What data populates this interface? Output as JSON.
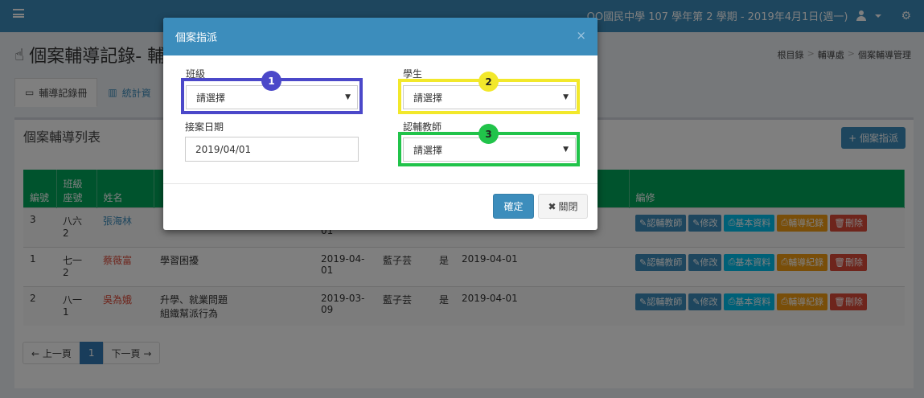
{
  "header": {
    "school_info": "OO國民中學 107 學年第 2 學期 - 2019年4月1日(週一)"
  },
  "page": {
    "title": "個案輔導記錄- 輔",
    "breadcrumb": [
      "根目錄",
      "輔導處",
      "個案輔導管理"
    ]
  },
  "tabs": [
    {
      "label": "輔導記錄冊"
    },
    {
      "label": "統計資"
    }
  ],
  "panel": {
    "title": "個案輔導列表",
    "assign_button": "+ 個案指派"
  },
  "table": {
    "headers": [
      "編號",
      "班級座號",
      "姓名",
      "",
      "",
      "",
      "",
      "",
      "",
      "",
      "編修"
    ],
    "header_class_line1": "班級",
    "header_class_line2": "座號",
    "rows": [
      {
        "no": "3",
        "cls": "八六 2",
        "name": "張海林",
        "issue1": "",
        "issue2": "",
        "date1": "",
        "date2": "01",
        "teacher": "",
        "yes": "",
        "date3": ""
      },
      {
        "no": "1",
        "cls": "七一 2",
        "name": "蔡薇富",
        "issue1": "學習困擾",
        "issue2": "",
        "date1": "2019-04-",
        "date2": "01",
        "teacher": "藍子芸",
        "yes": "是",
        "date3": "2019-04-01"
      },
      {
        "no": "2",
        "cls": "八一 1",
        "name": "吳為娥",
        "issue1": "升學、就業問題",
        "issue2": "組織幫派行為",
        "date1": "2019-03-",
        "date2": "09",
        "teacher": "藍子芸",
        "yes": "是",
        "date3": "2019-04-01"
      }
    ],
    "actions": [
      "認輔教師",
      "修改",
      "基本資料",
      "輔導紀錄",
      "刪除"
    ]
  },
  "pagination": {
    "prev": "← 上一頁",
    "current": "1",
    "next": "下一頁 →"
  },
  "modal": {
    "title": "個案指派",
    "close": "×",
    "class_label": "班級",
    "class_value": "請選擇",
    "student_label": "學生",
    "student_value": "請選擇",
    "date_label": "接案日期",
    "date_value": "2019/04/01",
    "teacher_label": "認輔教師",
    "teacher_value": "請選擇",
    "ok": "確定",
    "cancel": "關閉"
  },
  "annotations": [
    {
      "number": "1",
      "color": "#4b48c9"
    },
    {
      "number": "2",
      "color": "#f2e82b"
    },
    {
      "number": "3",
      "color": "#21c34a"
    }
  ]
}
